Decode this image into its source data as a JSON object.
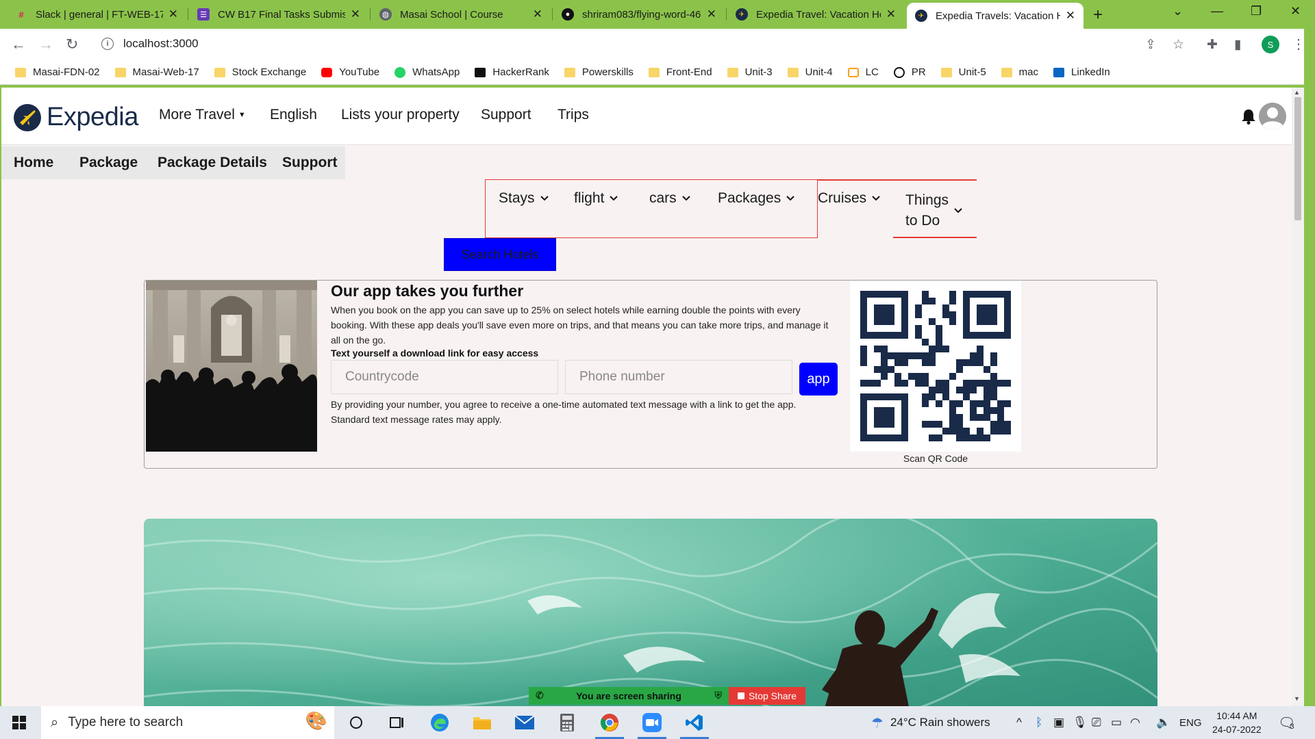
{
  "browser": {
    "tabs": [
      {
        "title": "Slack | general | FT-WEB-17",
        "icon": "slack-icon",
        "active": false
      },
      {
        "title": "CW B17 Final Tasks Submiss",
        "icon": "forms-icon",
        "active": false
      },
      {
        "title": "Masai School | Course",
        "icon": "globe-icon",
        "active": false
      },
      {
        "title": "shriram083/flying-word-46",
        "icon": "github-icon",
        "active": false
      },
      {
        "title": "Expedia Travel: Vacation Ho",
        "icon": "expedia-icon",
        "active": false
      },
      {
        "title": "Expedia Travels: Vacation H",
        "icon": "expedia-icon",
        "active": true
      }
    ],
    "url": "localhost:3000",
    "profile_initial": "S",
    "bookmarks": [
      {
        "label": "Masai-FDN-02",
        "icon": "folder-icon"
      },
      {
        "label": "Masai-Web-17",
        "icon": "folder-icon"
      },
      {
        "label": "Stock Exchange",
        "icon": "folder-icon"
      },
      {
        "label": "YouTube",
        "icon": "youtube-icon"
      },
      {
        "label": "WhatsApp",
        "icon": "whatsapp-icon"
      },
      {
        "label": "HackerRank",
        "icon": "hackerrank-icon"
      },
      {
        "label": "Powerskills",
        "icon": "folder-icon"
      },
      {
        "label": "Front-End",
        "icon": "folder-icon"
      },
      {
        "label": "Unit-3",
        "icon": "folder-icon"
      },
      {
        "label": "Unit-4",
        "icon": "folder-icon"
      },
      {
        "label": "LC",
        "icon": "leetcode-icon"
      },
      {
        "label": "PR",
        "icon": "pr-icon"
      },
      {
        "label": "Unit-5",
        "icon": "folder-icon"
      },
      {
        "label": "mac",
        "icon": "folder-icon"
      },
      {
        "label": "LinkedIn",
        "icon": "linkedin-icon"
      }
    ]
  },
  "site": {
    "brand": "Expedia",
    "nav": {
      "more_travel": "More Travel",
      "english": "English",
      "list_property": "Lists your property",
      "support": "Support",
      "trips": "Trips"
    },
    "subnav": [
      "Home",
      "Package",
      "Package Details",
      "Support"
    ],
    "categories": [
      "Stays",
      "flight",
      "cars",
      "Packages",
      "Cruises"
    ],
    "things_to_do": {
      "line1": "Things",
      "line2": "to Do"
    },
    "search_button": "Search Hotels"
  },
  "promo": {
    "title": "Our app takes you further",
    "body": "When you book on the app you can save up to 25% on select hotels while earning double the points with every booking. With these app deals you'll save even more on trips, and that means you can take more trips, and manage it all on the go.",
    "subtitle": "Text yourself a download link for easy access",
    "country_placeholder": "Countrycode",
    "phone_placeholder": "Phone number",
    "app_button": "app",
    "note": "By providing your number, you agree to receive a one-time automated text message with a link to get the app. Standard text message rates may apply.",
    "qr_caption": "Scan QR Code"
  },
  "screen_share": {
    "status": "You are screen sharing",
    "stop": "Stop Share"
  },
  "taskbar": {
    "search_placeholder": "Type here to search",
    "weather": "24°C  Rain showers",
    "language": "ENG",
    "time": "10:44 AM",
    "date": "24-07-2022",
    "notifications": "3"
  },
  "colors": {
    "frame_green": "#8bc34a",
    "brand_navy": "#1a2b49",
    "accent_blue": "#0000ff",
    "outline_red": "#e53935"
  }
}
